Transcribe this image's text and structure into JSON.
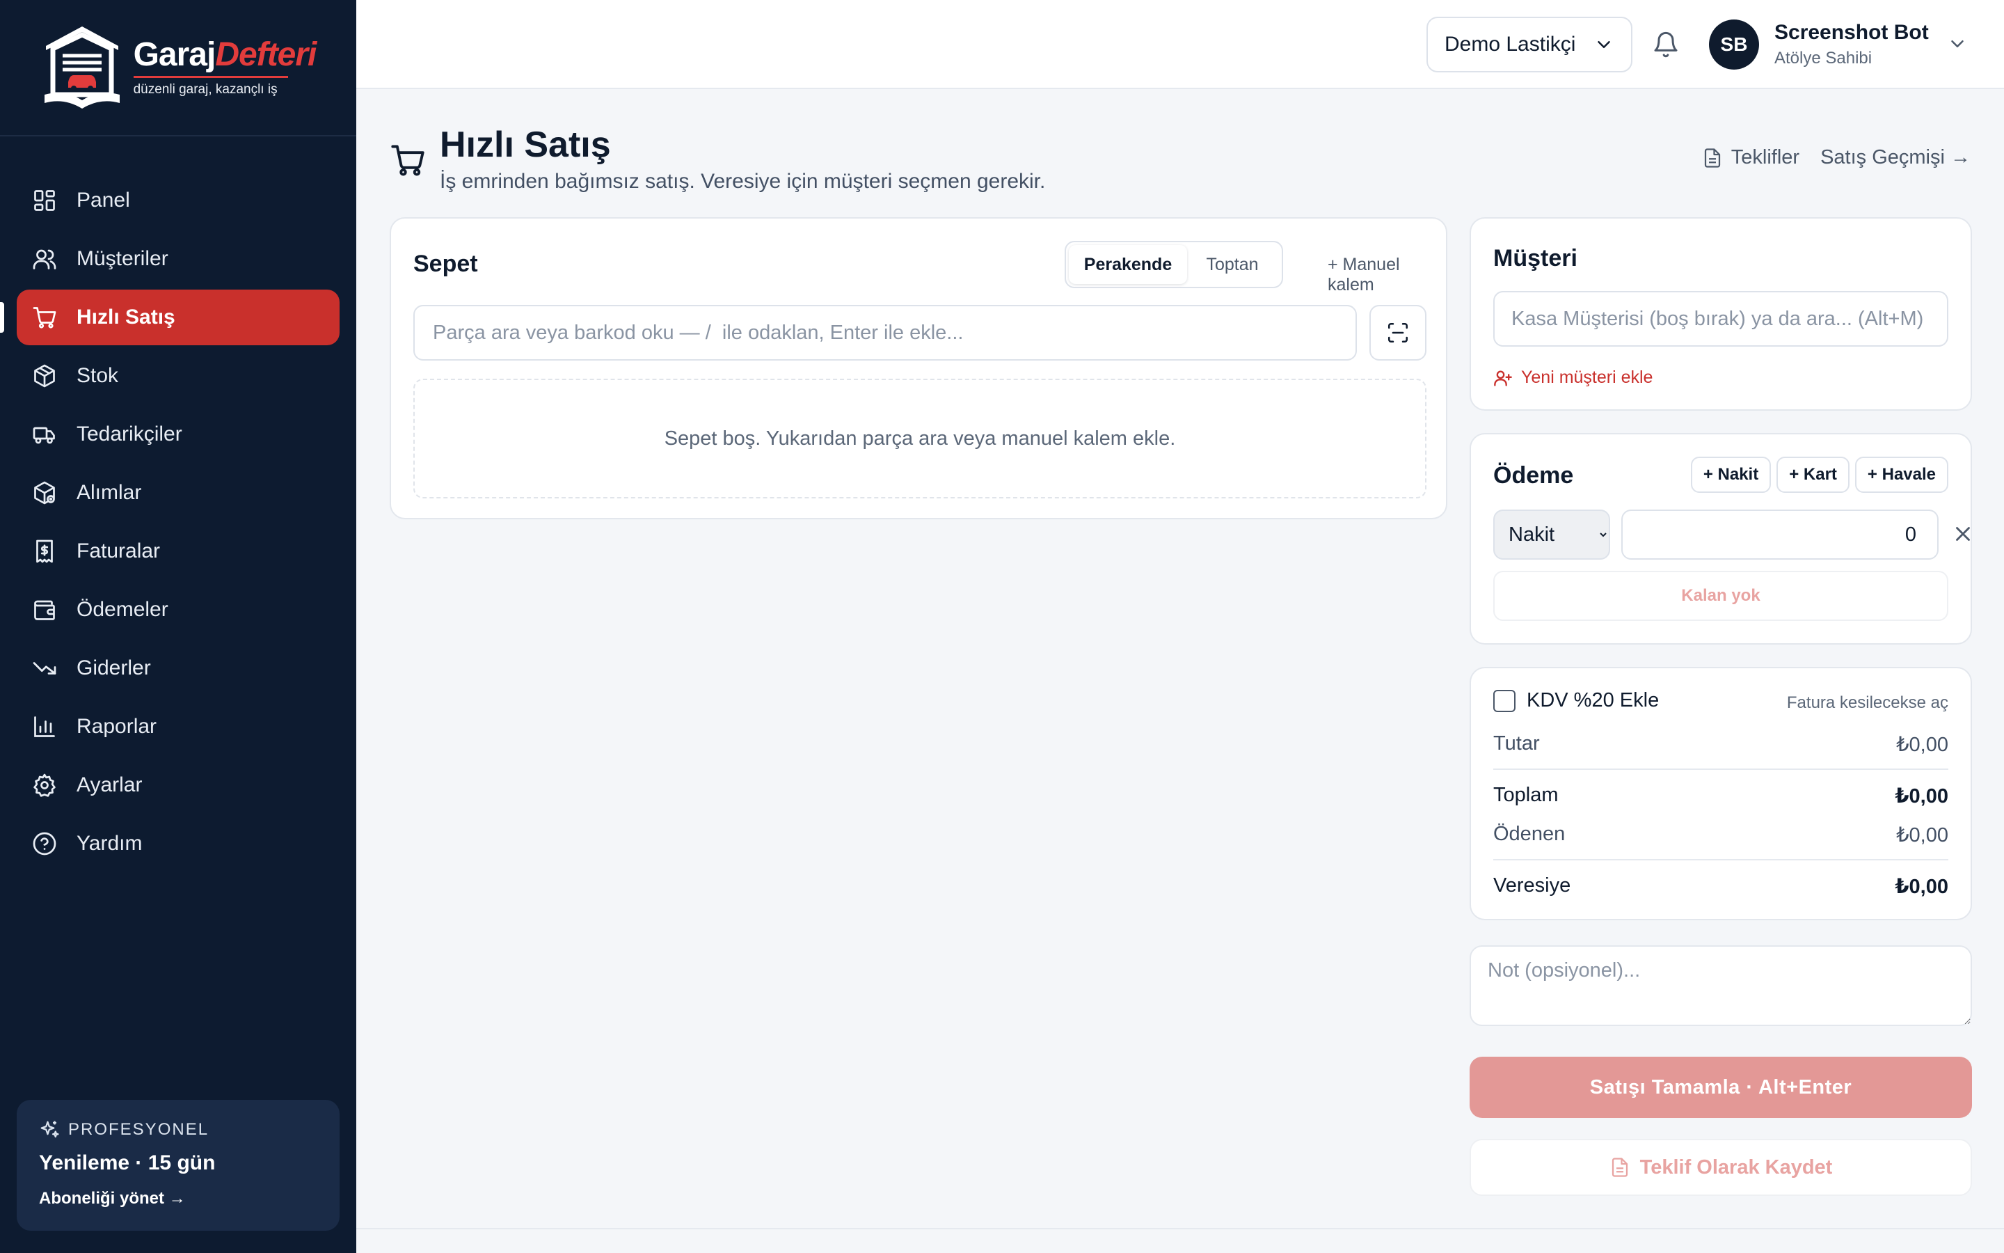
{
  "brand": {
    "name_part1": "Garaj",
    "name_part2": "Defteri",
    "tagline": "düzenli garaj, kazançlı iş",
    "accent_color": "#e23c3c"
  },
  "sidebar": {
    "items": [
      {
        "label": "Panel",
        "icon": "dashboard-icon"
      },
      {
        "label": "Müşteriler",
        "icon": "users-icon"
      },
      {
        "label": "Hızlı Satış",
        "icon": "cart-icon",
        "active": true
      },
      {
        "label": "Stok",
        "icon": "box-icon"
      },
      {
        "label": "Tedarikçiler",
        "icon": "truck-icon"
      },
      {
        "label": "Alımlar",
        "icon": "package-icon"
      },
      {
        "label": "Faturalar",
        "icon": "receipt-icon"
      },
      {
        "label": "Ödemeler",
        "icon": "wallet-icon"
      },
      {
        "label": "Giderler",
        "icon": "trending-down-icon"
      },
      {
        "label": "Raporlar",
        "icon": "bar-chart-icon"
      },
      {
        "label": "Ayarlar",
        "icon": "gear-icon"
      },
      {
        "label": "Yardım",
        "icon": "help-icon"
      }
    ],
    "plan": {
      "tier": "PROFESYONEL",
      "renewal": "Yenileme · 15 gün",
      "manage_link": "Aboneliği yönet →"
    },
    "bg_color": "#0d1b30",
    "active_color": "#c9302c"
  },
  "topbar": {
    "shop": "Demo Lastikçi",
    "user": {
      "initials": "SB",
      "name": "Screenshot Bot",
      "role": "Atölye Sahibi"
    }
  },
  "page": {
    "title": "Hızlı Satış",
    "subtitle": "İş emrinden bağımsız satış. Veresiye için müşteri seçmen gerekir.",
    "link_quotes": "Teklifler",
    "link_history": "Satış Geçmişi →"
  },
  "cart": {
    "title": "Sepet",
    "mode_retail": "Perakende",
    "mode_wholesale": "Toptan",
    "manual_link": "+ Manuel kalem",
    "search_placeholder": "Parça ara veya barkod oku — /  ile odaklan, Enter ile ekle...",
    "empty_text": "Sepet boş. Yukarıdan parça ara veya manuel kalem ekle."
  },
  "customer": {
    "title": "Müşteri",
    "placeholder": "Kasa Müşterisi (boş bırak) ya da ara... (Alt+M)",
    "new_link": "Yeni müşteri ekle"
  },
  "payment": {
    "title": "Ödeme",
    "chips": [
      "+ Nakit",
      "+ Kart",
      "+ Havale"
    ],
    "method": "Nakit",
    "amount": "0",
    "remaining": "Kalan yok"
  },
  "summary": {
    "vat_label": "KDV %20 Ekle",
    "vat_hint": "Fatura kesilecekse aç",
    "subtotal_label": "Tutar",
    "subtotal_value": "₺0,00",
    "total_label": "Toplam",
    "total_value": "₺0,00",
    "paid_label": "Ödenen",
    "paid_value": "₺0,00",
    "credit_label": "Veresiye",
    "credit_value": "₺0,00"
  },
  "note_placeholder": "Not (opsiyonel)...",
  "complete_button": "Satışı Tamamla · Alt+Enter",
  "quote_button": "Teklif Olarak Kaydet"
}
